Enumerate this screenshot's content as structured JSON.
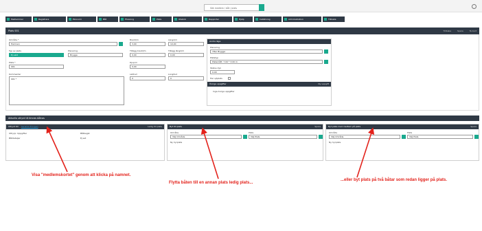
{
  "top": {
    "search_placeholder": "Sök medlem / båt / plats"
  },
  "toolbar": [
    {
      "label": "Medlemmar"
    },
    {
      "label": "Registrera"
    },
    {
      "label": "Ekonomi"
    },
    {
      "label": "Båt"
    },
    {
      "label": "Förening"
    },
    {
      "label": "Plats"
    },
    {
      "label": "Utskick"
    },
    {
      "label": "Rapporter"
    },
    {
      "label": "Hjälp"
    },
    {
      "label": "Inställning"
    },
    {
      "label": "Administration"
    },
    {
      "label": "Tillbaka"
    }
  ],
  "page": {
    "title": "Plats 001",
    "actions": [
      "Tillbaka",
      "Spara",
      "Ta bort"
    ]
  },
  "form": {
    "omrade_label": "Område *",
    "omrade_value": "Hamnen",
    "typ_label": "Typ av plats",
    "typ_value": "Ej vald",
    "placering_label": "Placering",
    "placering_value": "Brygga",
    "plats_label": "Plats *",
    "plats_value": "001",
    "kommentar_label": "Kommentar",
    "kommentar_value": "001 *",
    "bredd_label": "Bredd/m",
    "bredd_value": "3,00",
    "langd_label": "Längd/m",
    "langd_value": "10,00",
    "tillagg_bredd_label": "Tillägg bredd/m",
    "tillagg_bredd_value": "0,00",
    "tillagg_langd_label": "Tillägg längd/m",
    "tillagg_langd_value": "0,00",
    "djup_label": "Djup/m",
    "djup_value": "0,00",
    "latitud_label": "Latitud",
    "latitud_value": "0",
    "longitud_label": "Longitud",
    "longitud_value": "0"
  },
  "right_panel": {
    "title": "Andra läge",
    "f1_label": "Placering",
    "f1_value": "Ytter Brygga",
    "f2_label": "Platstyp",
    "f2_value": "Platsmått: 7.00 * 3.00 m",
    "f3_label": "Status dyk",
    "f3_value": "0,00",
    "check_label": "Har sjöplats",
    "sub_title": "Övriga uppgifter",
    "sub_action": "Ny uppgift",
    "sub_text": "Inga övriga uppgifter"
  },
  "section": {
    "title": "Aktuella uthyrd till ämnes båtnas"
  },
  "bottom": {
    "p1": {
      "title": "Uthyrd till",
      "title_link": "Saramiz Erorgen",
      "action": "Ledig till plats",
      "row1_left": "Uthyrp: Uppgifter",
      "row1_right": "Båtbegär",
      "row2_left": "Båtdetaljer",
      "row2_right": "Ej sat"
    },
    "p2": {
      "title": "Byt till plats",
      "action": "Spara",
      "omrade_label": "Område",
      "omrade_value": "Välj Område",
      "plats_label": "Plats",
      "plats_value": "Välj Plats",
      "note": "Ny hyrplats"
    },
    "p3": {
      "title": "Byt plats med medlem på plats",
      "action": "Spara",
      "omrade_label": "Område",
      "omrade_value": "Välj Område",
      "plats_label": "Plats",
      "plats_value": "Välj Plats",
      "note": "Ny hyrplats"
    }
  },
  "annotations": {
    "a1": "Visa \"medlemskortet\" genom att klicka på namnet.",
    "a2": "Flytta båten till en annan plats ledig plats...",
    "a3": "...eller byt plats på två båtar som redan ligger på plats."
  },
  "colors": {
    "dark": "#2f3945",
    "green": "#1aa98e",
    "annotation": "#e3221b"
  }
}
